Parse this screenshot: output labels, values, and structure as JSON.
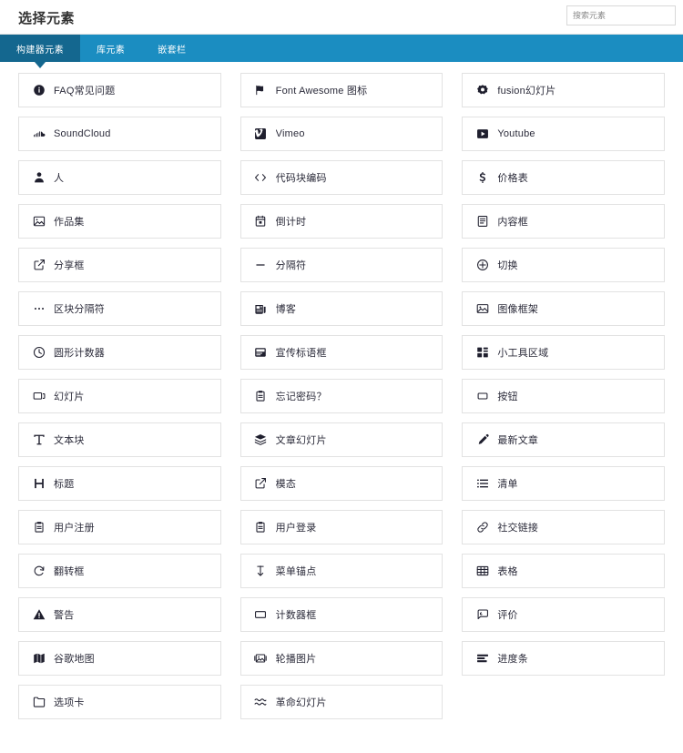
{
  "header": {
    "title": "选择元素",
    "search": {
      "placeholder": "搜索元素",
      "value": ""
    }
  },
  "tabs": [
    {
      "label": "构建器元素",
      "active": true
    },
    {
      "label": "库元素",
      "active": false
    },
    {
      "label": "嵌套栏",
      "active": false
    }
  ],
  "colors": {
    "tabbar": "#1b8dc1",
    "tab_active": "#14678f",
    "card_border": "#e2e2e2",
    "text": "#2b2b3a"
  },
  "elements": [
    {
      "label": "FAQ常见问题",
      "icon": "info-circle-icon"
    },
    {
      "label": "Font Awesome 图标",
      "icon": "flag-icon"
    },
    {
      "label": "fusion幻灯片",
      "icon": "cog-icon"
    },
    {
      "label": "SoundCloud",
      "icon": "soundcloud-icon"
    },
    {
      "label": "Vimeo",
      "icon": "vimeo-icon"
    },
    {
      "label": "Youtube",
      "icon": "youtube-icon"
    },
    {
      "label": "人",
      "icon": "person-icon"
    },
    {
      "label": "代码块编码",
      "icon": "code-icon"
    },
    {
      "label": "价格表",
      "icon": "dollar-icon"
    },
    {
      "label": "作品集",
      "icon": "portfolio-icon"
    },
    {
      "label": "倒计时",
      "icon": "calendar-icon"
    },
    {
      "label": "内容框",
      "icon": "content-box-icon"
    },
    {
      "label": "分享框",
      "icon": "share-box-icon"
    },
    {
      "label": "分隔符",
      "icon": "minus-icon"
    },
    {
      "label": "切换",
      "icon": "toggle-icon"
    },
    {
      "label": "区块分隔符",
      "icon": "ellipsis-icon"
    },
    {
      "label": "博客",
      "icon": "newspaper-icon"
    },
    {
      "label": "图像框架",
      "icon": "image-frame-icon"
    },
    {
      "label": "圆形计数器",
      "icon": "clock-icon"
    },
    {
      "label": "宣传标语框",
      "icon": "tagline-box-icon"
    },
    {
      "label": "小工具区域",
      "icon": "widget-grid-icon"
    },
    {
      "label": "幻灯片",
      "icon": "slider-icon"
    },
    {
      "label": "忘记密码？",
      "icon": "clipboard-icon"
    },
    {
      "label": "按钮",
      "icon": "button-icon"
    },
    {
      "label": "文本块",
      "icon": "text-icon"
    },
    {
      "label": "文章幻灯片",
      "icon": "layers-icon"
    },
    {
      "label": "最新文章",
      "icon": "pencil-icon"
    },
    {
      "label": "标题",
      "icon": "heading-icon"
    },
    {
      "label": "模态",
      "icon": "modal-icon"
    },
    {
      "label": "清单",
      "icon": "list-icon"
    },
    {
      "label": "用户注册",
      "icon": "clipboard-icon"
    },
    {
      "label": "用户登录",
      "icon": "clipboard-icon"
    },
    {
      "label": "社交链接",
      "icon": "link-icon"
    },
    {
      "label": "翻转框",
      "icon": "refresh-icon"
    },
    {
      "label": "菜单锚点",
      "icon": "anchor-icon"
    },
    {
      "label": "表格",
      "icon": "table-icon"
    },
    {
      "label": "警告",
      "icon": "warning-icon"
    },
    {
      "label": "计数器框",
      "icon": "counter-box-icon"
    },
    {
      "label": "评价",
      "icon": "testimonial-icon"
    },
    {
      "label": "谷歌地图",
      "icon": "map-icon"
    },
    {
      "label": "轮播图片",
      "icon": "carousel-icon"
    },
    {
      "label": "进度条",
      "icon": "progress-bar-icon"
    },
    {
      "label": "选项卡",
      "icon": "tabs-icon"
    },
    {
      "label": "革命幻灯片",
      "icon": "waves-icon"
    }
  ]
}
